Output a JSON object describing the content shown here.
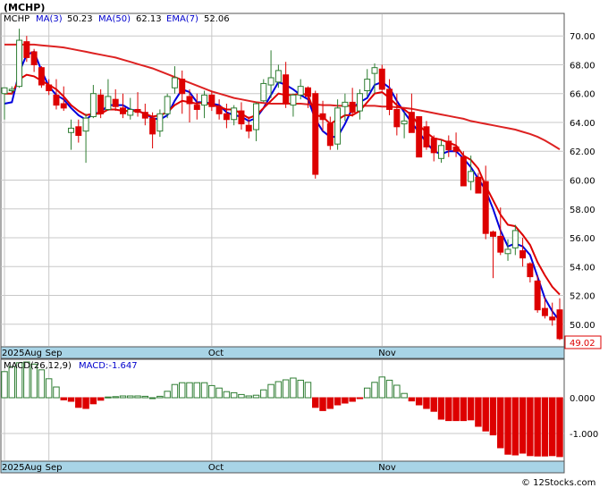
{
  "title": "(MCHP)",
  "watermark": "© 12Stocks.com",
  "price_panel": {
    "legend": {
      "ticker": "MCHP",
      "ma3_label": "MA(3)",
      "ma3_value": "50.23",
      "ma50_label": "MA(50)",
      "ma50_value": "62.13",
      "ema7_label": "EMA(7)",
      "ema7_value": "52.06"
    },
    "last_price": "49.02",
    "colors": {
      "up": "#2e7d32",
      "down": "#dd0000",
      "ma3": "#0000dd",
      "ma50": "#dd2222",
      "ema7": "#dd0000",
      "grid": "#c8c8c8",
      "axis_bar": "#a8d4e6"
    }
  },
  "macd_panel": {
    "legend": {
      "label": "MACD(26,12,9)",
      "value_label": "MACD:-1.647"
    },
    "colors": {
      "pos": "#2e7d32",
      "neg": "#dd0000"
    }
  },
  "x_axis": {
    "labels": [
      "2025Aug",
      "Sep",
      "Oct",
      "Nov"
    ]
  },
  "chart_data": [
    {
      "type": "candlestick",
      "name": "MCHP daily price",
      "ylim": [
        48.5,
        71.5
      ],
      "yticks": [
        50,
        52,
        54,
        56,
        58,
        60,
        62,
        64,
        66,
        68,
        70
      ],
      "x_labels": [
        {
          "text": "2025Aug",
          "index": 0
        },
        {
          "text": "Sep",
          "index": 6
        },
        {
          "text": "Oct",
          "index": 28
        },
        {
          "text": "Nov",
          "index": 51
        }
      ],
      "candles": [
        [
          66.0,
          66.4,
          64.2,
          66.4
        ],
        [
          66.2,
          66.5,
          66.0,
          66.3
        ],
        [
          66.5,
          70.5,
          66.4,
          69.7
        ],
        [
          69.6,
          70.0,
          68.2,
          68.5
        ],
        [
          68.9,
          69.1,
          67.5,
          68.0
        ],
        [
          67.8,
          67.9,
          66.4,
          66.6
        ],
        [
          66.6,
          67.0,
          65.9,
          66.2
        ],
        [
          65.9,
          67.0,
          64.9,
          65.2
        ],
        [
          65.3,
          66.5,
          64.8,
          65.0
        ],
        [
          63.3,
          64.2,
          62.1,
          63.6
        ],
        [
          63.7,
          64.2,
          62.6,
          63.1
        ],
        [
          63.4,
          64.6,
          61.2,
          64.3
        ],
        [
          64.4,
          66.6,
          64.3,
          66.0
        ],
        [
          65.9,
          66.3,
          64.3,
          64.6
        ],
        [
          64.9,
          67.0,
          64.8,
          65.8
        ],
        [
          65.6,
          66.3,
          64.8,
          65.1
        ],
        [
          65.0,
          66.0,
          64.3,
          64.6
        ],
        [
          64.5,
          65.7,
          64.2,
          64.9
        ],
        [
          64.9,
          66.1,
          64.4,
          64.7
        ],
        [
          64.7,
          65.3,
          63.8,
          64.3
        ],
        [
          64.3,
          64.7,
          62.2,
          63.2
        ],
        [
          63.4,
          64.9,
          63.0,
          64.6
        ],
        [
          64.6,
          66.0,
          64.3,
          65.8
        ],
        [
          66.4,
          67.9,
          66.0,
          67.1
        ],
        [
          67.0,
          67.6,
          64.6,
          66.0
        ],
        [
          65.8,
          66.3,
          64.0,
          65.3
        ],
        [
          65.2,
          66.0,
          64.2,
          64.9
        ],
        [
          65.2,
          66.2,
          64.3,
          65.9
        ],
        [
          65.9,
          66.2,
          64.8,
          65.1
        ],
        [
          65.1,
          65.6,
          64.2,
          64.6
        ],
        [
          64.6,
          65.3,
          63.6,
          64.2
        ],
        [
          64.2,
          65.2,
          63.8,
          65.0
        ],
        [
          64.8,
          65.4,
          63.5,
          63.9
        ],
        [
          63.8,
          64.4,
          62.9,
          63.4
        ],
        [
          63.5,
          65.4,
          62.7,
          65.3
        ],
        [
          65.5,
          67.0,
          65.4,
          66.7
        ],
        [
          66.6,
          69.0,
          65.7,
          67.1
        ],
        [
          66.8,
          68.0,
          66.4,
          67.6
        ],
        [
          67.3,
          68.2,
          65.0,
          65.3
        ],
        [
          65.2,
          66.0,
          64.4,
          65.9
        ],
        [
          65.9,
          67.0,
          65.6,
          66.5
        ],
        [
          66.4,
          66.5,
          65.0,
          65.8
        ],
        [
          66.0,
          66.2,
          60.1,
          60.4
        ],
        [
          64.6,
          65.5,
          63.4,
          64.2
        ],
        [
          63.9,
          64.4,
          62.1,
          62.4
        ],
        [
          62.5,
          65.6,
          62.1,
          65.0
        ],
        [
          65.1,
          66.0,
          64.1,
          65.4
        ],
        [
          65.4,
          66.4,
          64.4,
          64.7
        ],
        [
          64.8,
          66.3,
          64.2,
          66.0
        ],
        [
          66.2,
          67.7,
          65.8,
          67.0
        ],
        [
          67.4,
          68.1,
          66.0,
          67.8
        ],
        [
          67.7,
          68.0,
          66.2,
          66.3
        ],
        [
          66.3,
          67.0,
          64.5,
          64.9
        ],
        [
          64.9,
          66.0,
          63.1,
          63.7
        ],
        [
          63.9,
          64.7,
          62.9,
          64.1
        ],
        [
          64.7,
          66.0,
          63.5,
          63.3
        ],
        [
          64.4,
          64.4,
          61.6,
          61.6
        ],
        [
          63.7,
          64.1,
          62.1,
          62.3
        ],
        [
          62.9,
          63.1,
          61.3,
          61.9
        ],
        [
          61.5,
          62.8,
          61.2,
          62.4
        ],
        [
          62.7,
          63.1,
          61.6,
          62.1
        ],
        [
          62.3,
          63.3,
          61.6,
          62.0
        ],
        [
          61.6,
          62.0,
          59.6,
          59.6
        ],
        [
          59.9,
          61.7,
          59.3,
          60.6
        ],
        [
          60.2,
          60.5,
          59.1,
          59.1
        ],
        [
          59.9,
          61.0,
          55.9,
          56.3
        ],
        [
          56.4,
          56.5,
          53.2,
          56.1
        ],
        [
          56.1,
          58.1,
          54.8,
          55.0
        ],
        [
          54.9,
          55.9,
          54.4,
          55.2
        ],
        [
          55.3,
          56.9,
          54.8,
          56.5
        ],
        [
          55.1,
          56.0,
          54.0,
          54.6
        ],
        [
          54.2,
          54.3,
          52.9,
          53.3
        ],
        [
          53.0,
          53.4,
          50.8,
          51.0
        ],
        [
          51.1,
          51.9,
          50.4,
          50.6
        ],
        [
          50.5,
          51.5,
          49.9,
          50.3
        ],
        [
          51.0,
          51.8,
          48.9,
          49.0
        ]
      ],
      "series": [
        {
          "name": "MA(3)",
          "values": [
            65.3,
            65.4,
            67.5,
            68.7,
            68.9,
            67.6,
            66.5,
            65.9,
            65.6,
            65.0,
            64.5,
            64.2,
            64.6,
            64.7,
            65.2,
            65.2,
            65.2,
            64.9,
            64.8,
            64.6,
            64.3,
            64.2,
            64.5,
            65.5,
            66.3,
            66.1,
            65.4,
            65.4,
            65.3,
            65.2,
            64.7,
            64.5,
            64.4,
            64.1,
            64.3,
            65.0,
            65.9,
            66.8,
            66.6,
            66.3,
            65.9,
            65.6,
            64.2,
            63.4,
            63.0,
            63.0,
            63.9,
            65.0,
            65.4,
            65.7,
            66.6,
            66.8,
            66.4,
            65.5,
            64.7,
            64.0,
            63.3,
            62.6,
            62.0,
            61.8,
            62.0,
            62.0,
            61.5,
            60.9,
            60.1,
            59.3,
            58.0,
            56.5,
            55.4,
            55.6,
            55.4,
            54.8,
            53.3,
            51.8,
            50.9,
            50.23
          ]
        },
        {
          "name": "MA(50)",
          "values": [
            69.4,
            69.4,
            69.4,
            69.4,
            69.4,
            69.35,
            69.3,
            69.25,
            69.2,
            69.1,
            69.0,
            68.9,
            68.8,
            68.7,
            68.6,
            68.5,
            68.35,
            68.2,
            68.05,
            67.9,
            67.75,
            67.55,
            67.35,
            67.15,
            66.95,
            66.75,
            66.55,
            66.35,
            66.15,
            66.0,
            65.85,
            65.7,
            65.6,
            65.5,
            65.4,
            65.35,
            65.3,
            65.3,
            65.3,
            65.3,
            65.3,
            65.25,
            65.25,
            65.2,
            65.2,
            65.15,
            65.15,
            65.15,
            65.15,
            65.15,
            65.15,
            65.1,
            65.1,
            65.05,
            65.0,
            64.95,
            64.85,
            64.75,
            64.65,
            64.55,
            64.45,
            64.35,
            64.25,
            64.1,
            64.0,
            63.9,
            63.8,
            63.7,
            63.6,
            63.5,
            63.35,
            63.2,
            63.0,
            62.75,
            62.45,
            62.13
          ]
        },
        {
          "name": "EMA(7)",
          "values": [
            66.0,
            66.0,
            67.0,
            67.3,
            67.2,
            66.9,
            66.6,
            66.3,
            65.8,
            65.2,
            64.8,
            64.5,
            64.6,
            64.6,
            64.9,
            64.9,
            64.8,
            64.8,
            64.8,
            64.6,
            64.4,
            64.5,
            64.7,
            65.2,
            65.5,
            65.4,
            65.3,
            65.4,
            65.2,
            65.1,
            64.9,
            64.9,
            64.6,
            64.3,
            64.5,
            65.0,
            65.5,
            66.0,
            65.9,
            65.9,
            66.0,
            65.9,
            64.5,
            64.4,
            63.9,
            64.2,
            64.5,
            64.5,
            64.8,
            65.4,
            66.0,
            66.1,
            65.7,
            65.2,
            64.9,
            64.5,
            63.8,
            63.3,
            62.9,
            62.8,
            62.6,
            62.4,
            61.7,
            61.4,
            60.8,
            59.6,
            58.6,
            57.6,
            56.9,
            56.8,
            56.2,
            55.5,
            54.3,
            53.4,
            52.6,
            52.06
          ]
        }
      ]
    },
    {
      "type": "bar",
      "name": "MACD histogram",
      "ylim": [
        -1.75,
        1.05
      ],
      "yticks": [
        0.0,
        -1.0
      ],
      "ytick_labels": [
        "0.000",
        "-1.000"
      ],
      "values": [
        0.73,
        0.87,
        0.98,
        1.0,
        0.94,
        0.78,
        0.53,
        0.3,
        -0.06,
        -0.1,
        -0.27,
        -0.3,
        -0.17,
        -0.07,
        0.02,
        0.03,
        0.05,
        0.05,
        0.05,
        0.04,
        0.0,
        0.04,
        0.18,
        0.37,
        0.42,
        0.42,
        0.42,
        0.42,
        0.34,
        0.27,
        0.17,
        0.14,
        0.09,
        0.05,
        0.07,
        0.22,
        0.37,
        0.45,
        0.5,
        0.55,
        0.49,
        0.43,
        -0.27,
        -0.36,
        -0.3,
        -0.2,
        -0.15,
        -0.1,
        -0.01,
        0.27,
        0.43,
        0.58,
        0.49,
        0.35,
        0.12,
        -0.09,
        -0.2,
        -0.3,
        -0.38,
        -0.6,
        -0.64,
        -0.64,
        -0.64,
        -0.62,
        -0.8,
        -0.93,
        -1.04,
        -1.4,
        -1.58,
        -1.6,
        -1.55,
        -1.62,
        -1.63,
        -1.63,
        -1.62,
        -1.647
      ]
    }
  ]
}
